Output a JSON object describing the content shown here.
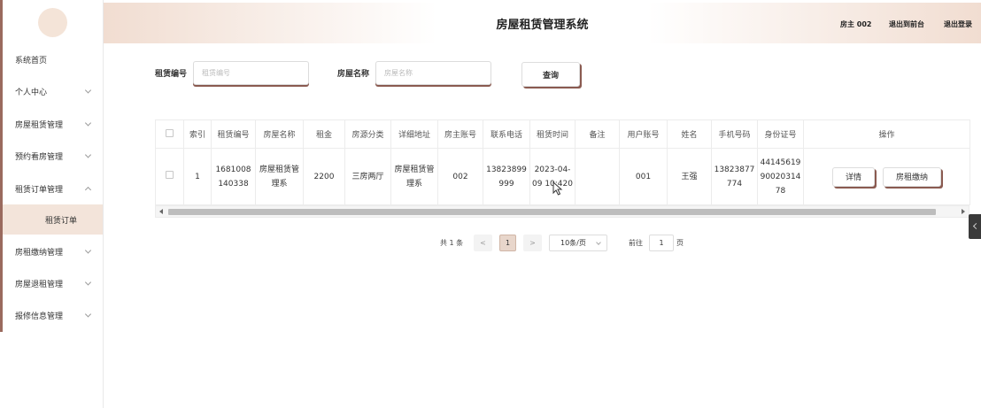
{
  "header": {
    "title": "房屋租赁管理系统",
    "user": "房主 002",
    "back_to_front": "退出到前台",
    "logout": "退出登录"
  },
  "sidebar": {
    "items": [
      {
        "label": "系统首页",
        "has_arrow": false
      },
      {
        "label": "个人中心",
        "has_arrow": true
      },
      {
        "label": "房屋租赁管理",
        "has_arrow": true
      },
      {
        "label": "预约看房管理",
        "has_arrow": true
      },
      {
        "label": "租赁订单管理",
        "has_arrow": true,
        "expanded": true
      },
      {
        "label": "房租缴纳管理",
        "has_arrow": true
      },
      {
        "label": "房屋退租管理",
        "has_arrow": true
      },
      {
        "label": "报修信息管理",
        "has_arrow": true
      }
    ],
    "active_sub": "租赁订单"
  },
  "search": {
    "code_label": "租赁编号",
    "code_placeholder": "租赁编号",
    "name_label": "房屋名称",
    "name_placeholder": "房屋名称",
    "query_button": "查询"
  },
  "table": {
    "headers": [
      "索引",
      "租赁编号",
      "房屋名称",
      "租金",
      "房源分类",
      "详细地址",
      "房主账号",
      "联系电话",
      "租赁时间",
      "备注",
      "用户账号",
      "姓名",
      "手机号码",
      "身份证号",
      "操作"
    ],
    "rows": [
      {
        "index": "1",
        "code": "1681008140338",
        "house_name": "房屋租赁管理系",
        "rent": "2200",
        "category": "三房两厅",
        "address": "房屋租赁管理系",
        "owner_account": "002",
        "contact_phone": "13823899999",
        "rent_time": "2023-04-09 10:420",
        "remark": "",
        "user_account": "001",
        "name": "王强",
        "mobile": "13823877774",
        "id_card": "441456199002031478",
        "detail_button": "详情",
        "pay_button": "房租缴纳"
      }
    ]
  },
  "pagination": {
    "total": "共 1 条",
    "prev": "<",
    "current": "1",
    "next": ">",
    "page_size": "10条/页",
    "goto_label": "前往",
    "goto_value": "1",
    "page_suffix": "页"
  },
  "colors": {
    "accent": "#8a5a50",
    "sidebar_edge": "#9a6a5e",
    "active_bg": "#f3e4da",
    "header_gradient": "#f1ddd1"
  }
}
